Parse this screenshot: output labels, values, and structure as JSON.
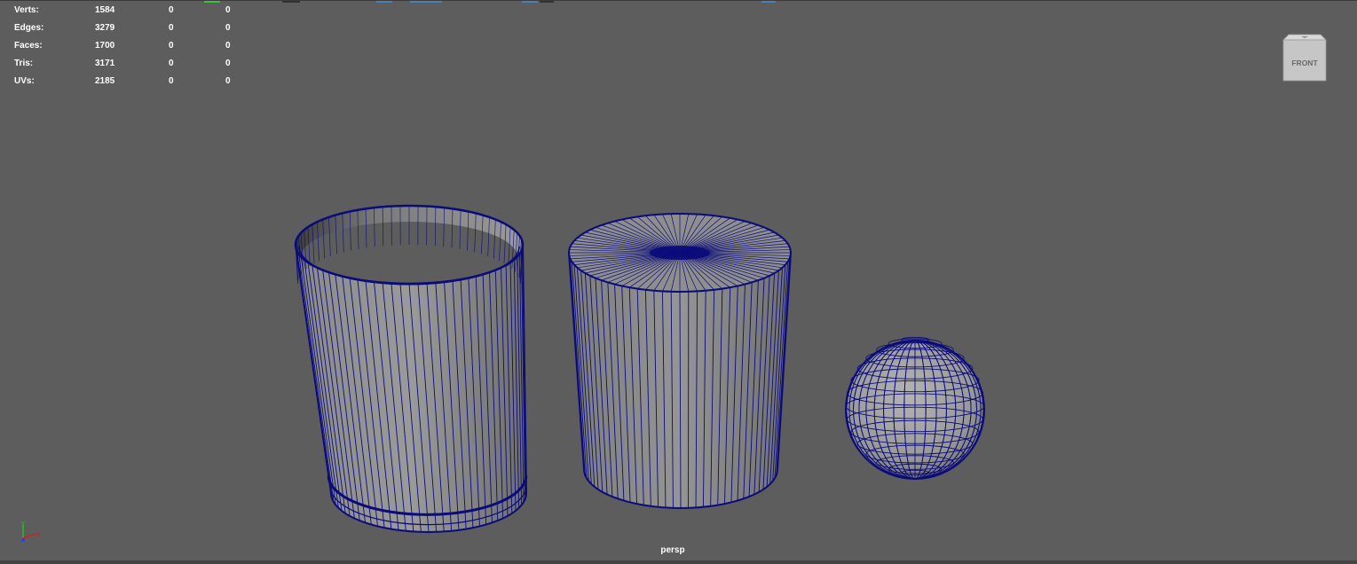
{
  "hud": {
    "rows": [
      {
        "label": "Verts:",
        "v1": "1584",
        "v2": "0",
        "v3": "0"
      },
      {
        "label": "Edges:",
        "v1": "3279",
        "v2": "0",
        "v3": "0"
      },
      {
        "label": "Faces:",
        "v1": "1700",
        "v2": "0",
        "v3": "0"
      },
      {
        "label": "Tris:",
        "v1": "3171",
        "v2": "0",
        "v3": "0"
      },
      {
        "label": "UVs:",
        "v1": "2185",
        "v2": "0",
        "v3": "0"
      }
    ]
  },
  "viewport": {
    "camera": "persp",
    "background_color": "#5d5d5d",
    "wire_color": "#0b0b7a"
  },
  "viewcube": {
    "face_label": "FRONT"
  },
  "axis_gizmo": {
    "y_label": "y",
    "x_label": "x",
    "colors": {
      "x": "#d02020",
      "y": "#20c020",
      "z": "#2040ff"
    }
  },
  "objects": [
    {
      "name": "cylinder-cup",
      "type": "open cylinder with rim"
    },
    {
      "name": "cylinder",
      "type": "closed cylinder"
    },
    {
      "name": "sphere",
      "type": "sphere"
    }
  ]
}
